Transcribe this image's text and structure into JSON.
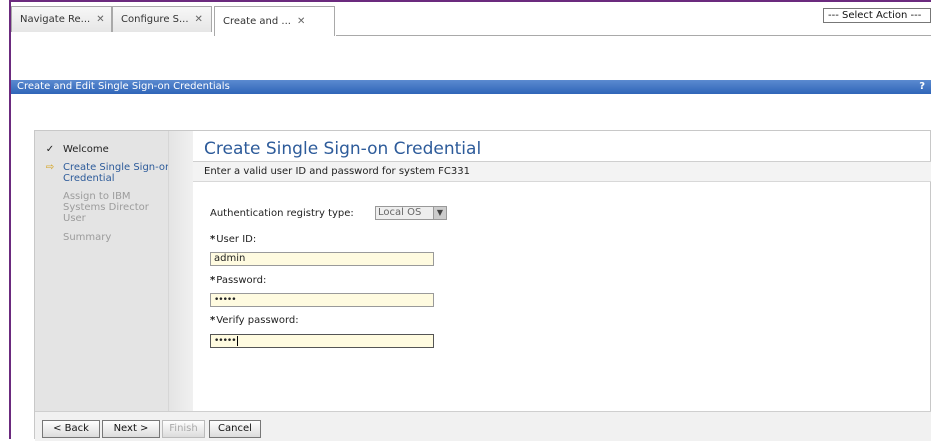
{
  "tabs": [
    {
      "label": "Navigate Re...",
      "close": "✕"
    },
    {
      "label": "Configure S...",
      "close": "✕"
    },
    {
      "label": "Create and ...",
      "close": "✕"
    }
  ],
  "select_action": "--- Select Action ---",
  "titlebar": {
    "title": "Create and Edit Single Sign-on Credentials",
    "help": "?"
  },
  "steps": [
    {
      "mark": "✓",
      "label": "Welcome"
    },
    {
      "mark": "⇨",
      "label": "Create Single Sign-on Credential"
    },
    {
      "mark": "",
      "label": "Assign to IBM Systems Director User"
    },
    {
      "mark": "",
      "label": "Summary"
    }
  ],
  "content": {
    "title": "Create Single Sign-on Credential",
    "instruction": "Enter a valid user ID and password for system FC331",
    "auth_label": "Authentication registry type:",
    "auth_value": "Local OS",
    "user_id_label": "User ID:",
    "user_id_value": "admin",
    "password_label": "Password:",
    "password_value": "•••••",
    "verify_label": "Verify password:",
    "verify_value": "•••••",
    "required_mark": "*"
  },
  "buttons": {
    "back": "< Back",
    "next": "Next >",
    "finish": "Finish",
    "cancel": "Cancel"
  }
}
